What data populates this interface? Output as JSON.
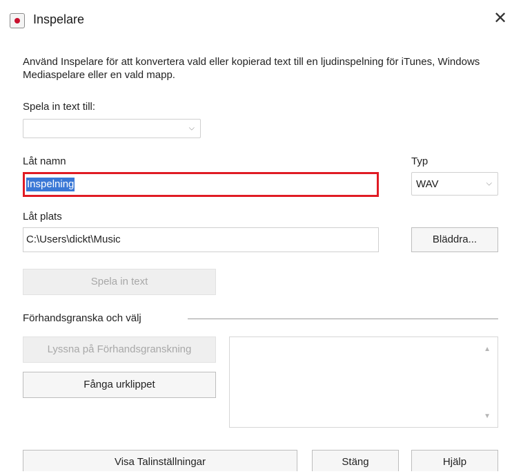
{
  "window": {
    "title": "Inspelare",
    "close_glyph": "✕"
  },
  "description": "Använd Inspelare för att konvertera vald eller kopierad text till en ljudinspelning för iTunes, Windows Mediaspelare eller en vald mapp.",
  "record_to": {
    "label": "Spela in text till:",
    "value": ""
  },
  "song_name": {
    "label": "Låt namn",
    "value": "Inspelning"
  },
  "type": {
    "label": "Typ",
    "value": "WAV"
  },
  "song_location": {
    "label": "Låt plats",
    "value": "C:\\Users\\dickt\\Music",
    "browse_label": "Bläddra..."
  },
  "record_button": "Spela in text",
  "preview": {
    "group_label": "Förhandsgranska och välj",
    "listen_label": "Lyssna på Förhandsgranskning",
    "capture_label": "Fånga urklippet"
  },
  "footer": {
    "speech_settings_label": "Visa Talinställningar",
    "close_label": "Stäng",
    "help_label": "Hjälp"
  },
  "colors": {
    "selection": "#3a78d6",
    "highlight": "#e01b24",
    "icon_dot": "#c8102e"
  },
  "icons": {
    "app": "record-icon",
    "dropdown": "chevron-down-icon",
    "scroll_up": "scroll-up-icon",
    "scroll_down": "scroll-down-icon"
  }
}
